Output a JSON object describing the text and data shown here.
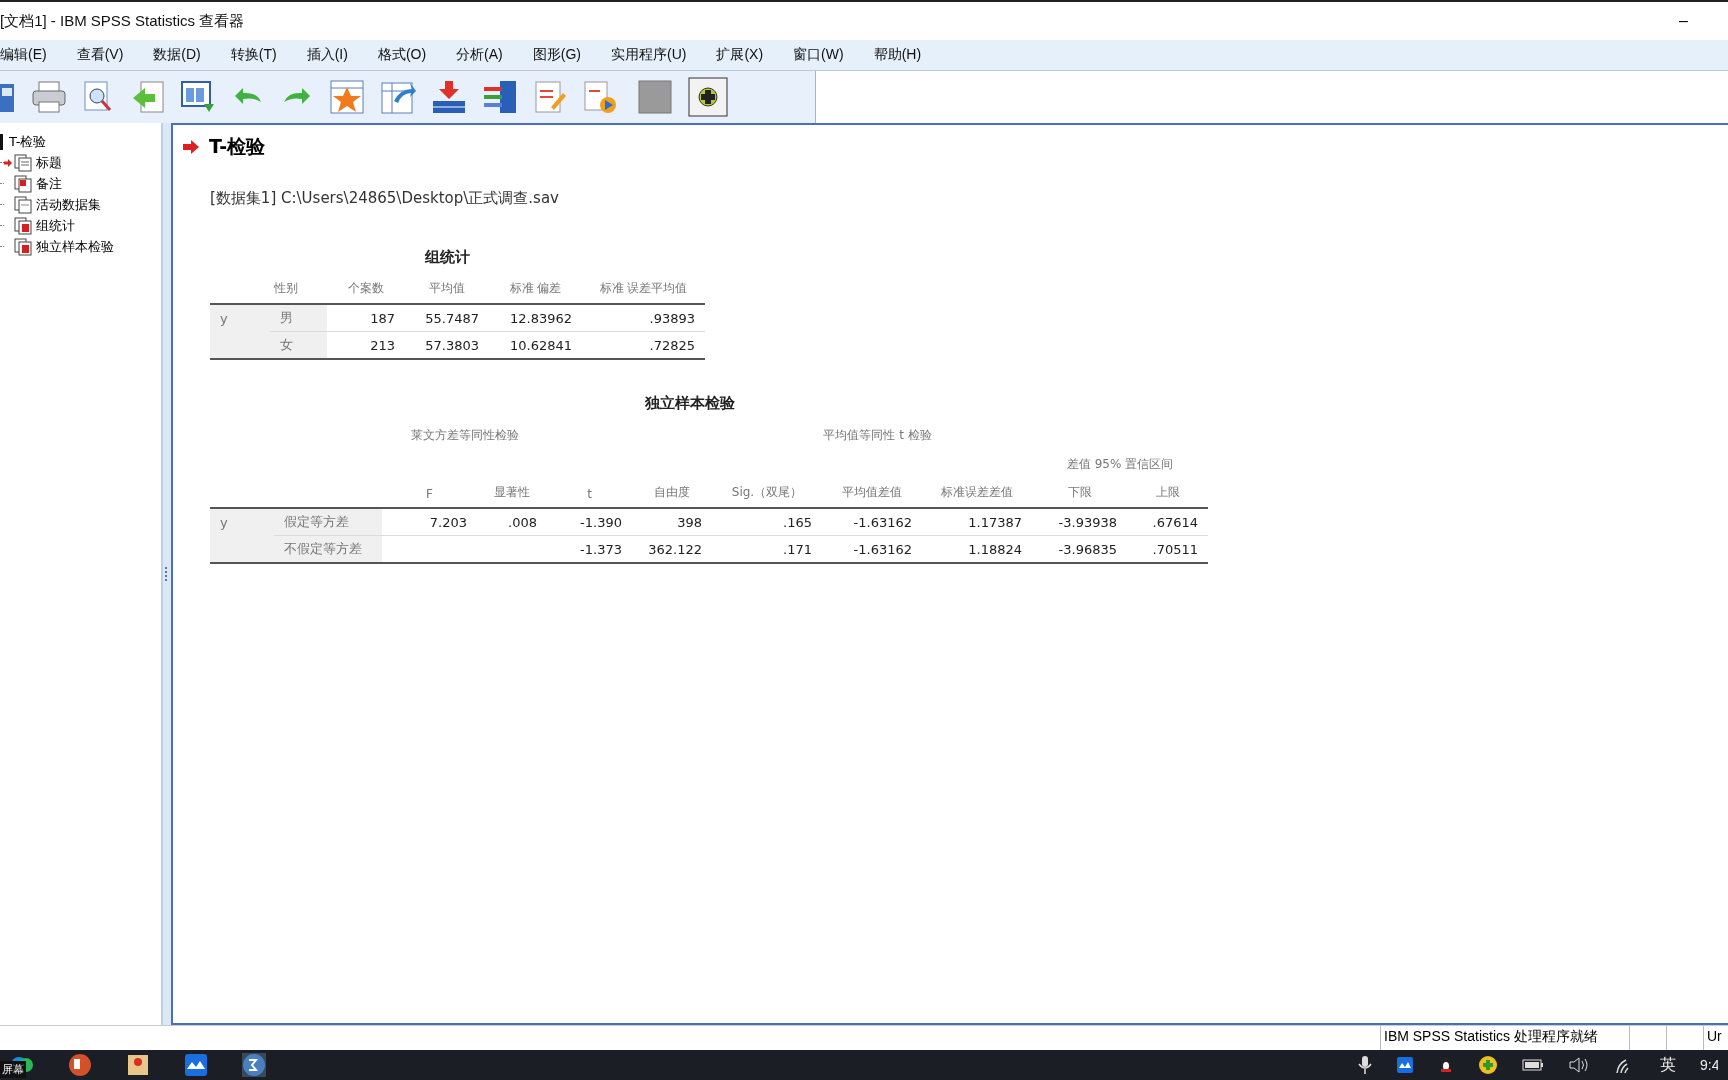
{
  "window": {
    "title": "[文档1] - IBM SPSS Statistics 查看器",
    "minimize": "–"
  },
  "menu": [
    "编辑(E)",
    "查看(V)",
    "数据(D)",
    "转换(T)",
    "插入(I)",
    "格式(O)",
    "分析(A)",
    "图形(G)",
    "实用程序(U)",
    "扩展(X)",
    "窗口(W)",
    "帮助(H)"
  ],
  "tree": [
    {
      "label": "T-检验",
      "expanded": true,
      "children": [
        {
          "label": "标题",
          "selected": true,
          "kind": "title"
        },
        {
          "label": "备注",
          "selected": false,
          "kind": "notes"
        },
        {
          "label": "活动数据集",
          "selected": false,
          "kind": "text"
        },
        {
          "label": "组统计",
          "selected": false,
          "kind": "table"
        },
        {
          "label": "独立样本检验",
          "selected": false,
          "kind": "table"
        }
      ]
    }
  ],
  "output": {
    "heading": "T-检验",
    "dataset": "[数据集1] C:\\Users\\24865\\Desktop\\正式调查.sav",
    "group_stats": {
      "title": "组统计",
      "columns": [
        "",
        "性别",
        "个案数",
        "平均值",
        "标准 偏差",
        "标准 误差平均值"
      ],
      "rows": [
        [
          "y",
          "男",
          "187",
          "55.7487",
          "12.83962",
          ".93893"
        ],
        [
          "",
          "女",
          "213",
          "57.3803",
          "10.62841",
          ".72825"
        ]
      ]
    },
    "indep_test": {
      "title": "独立样本检验",
      "group_levene": "莱文方差等同性检验",
      "group_t": "平均值等同性 t 检验",
      "group_ci": "差值 95% 置信区间",
      "columns": [
        "",
        "",
        "F",
        "显著性",
        "t",
        "自由度",
        "Sig.（双尾）",
        "平均值差值",
        "标准误差差值",
        "下限",
        "上限"
      ],
      "rows": [
        [
          "y",
          "假定等方差",
          "7.203",
          ".008",
          "-1.390",
          "398",
          ".165",
          "-1.63162",
          "1.17387",
          "-3.93938",
          ".67614"
        ],
        [
          "",
          "不假定等方差",
          "",
          "",
          "-1.373",
          "362.122",
          ".171",
          "-1.63162",
          "1.18824",
          "-3.96835",
          ".70511"
        ]
      ]
    }
  },
  "status_bar": {
    "message": "IBM SPSS Statistics 处理程序就绪",
    "cell_3": "Ur"
  },
  "taskbar": {
    "tooltip": "屏幕",
    "input_method": "英",
    "clock": "9:4"
  }
}
